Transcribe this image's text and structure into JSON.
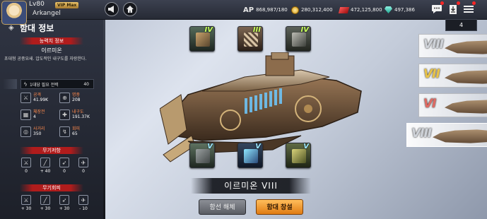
{
  "user": {
    "level": "Lv80",
    "vip": "VIP Max",
    "name": "Arkangel"
  },
  "resources": {
    "ap": {
      "label": "AP",
      "value": "868,987/180"
    },
    "gold": "280,312,400",
    "ruby": "472,125,800",
    "gem": "497,386"
  },
  "panel": {
    "title": "함대 정보",
    "ability_header": "능력치 정보",
    "ship_name": "이르미온",
    "description": "초대형 공중요새. 압도적인 내구도를 자랑한다.",
    "crew": {
      "label": "1대당 필요 전력",
      "value": "40"
    },
    "stats": [
      {
        "label": "공격",
        "value": "41.99K",
        "icon": "attack-icon"
      },
      {
        "label": "명중",
        "value": "208",
        "icon": "target-icon"
      },
      {
        "label": "체장전",
        "value": "4",
        "icon": "reload-icon"
      },
      {
        "label": "내구도",
        "value": "191.37K",
        "icon": "durability-icon"
      },
      {
        "label": "사거리",
        "value": "350",
        "icon": "range-icon"
      },
      {
        "label": "회피",
        "value": "65",
        "icon": "evasion-icon"
      }
    ],
    "weapon_resist_header": "무기저항",
    "weapon_resist": [
      "0",
      "+ 40",
      "0",
      "0"
    ],
    "weapon_evasion_header": "무기회피",
    "weapon_evasion": [
      "+ 30",
      "+ 30",
      "+ 30",
      "- 10"
    ]
  },
  "center": {
    "top_slots": [
      "IV",
      "III",
      "IV"
    ],
    "bottom_slots": [
      "V",
      "V",
      "V"
    ],
    "ship_title": "이르미온 VIII",
    "dismantle_label": "함선 해체",
    "select_label": "함대 창설"
  },
  "fleet": {
    "count": "4",
    "cards": [
      {
        "roman": "VIII"
      },
      {
        "roman": "VII"
      },
      {
        "roman": "VI"
      },
      {
        "roman": "VIII"
      }
    ]
  },
  "colors": {
    "accent": "#f59a2a",
    "header_red": "#b01c1c",
    "stat_label": "#ff8a4c"
  }
}
